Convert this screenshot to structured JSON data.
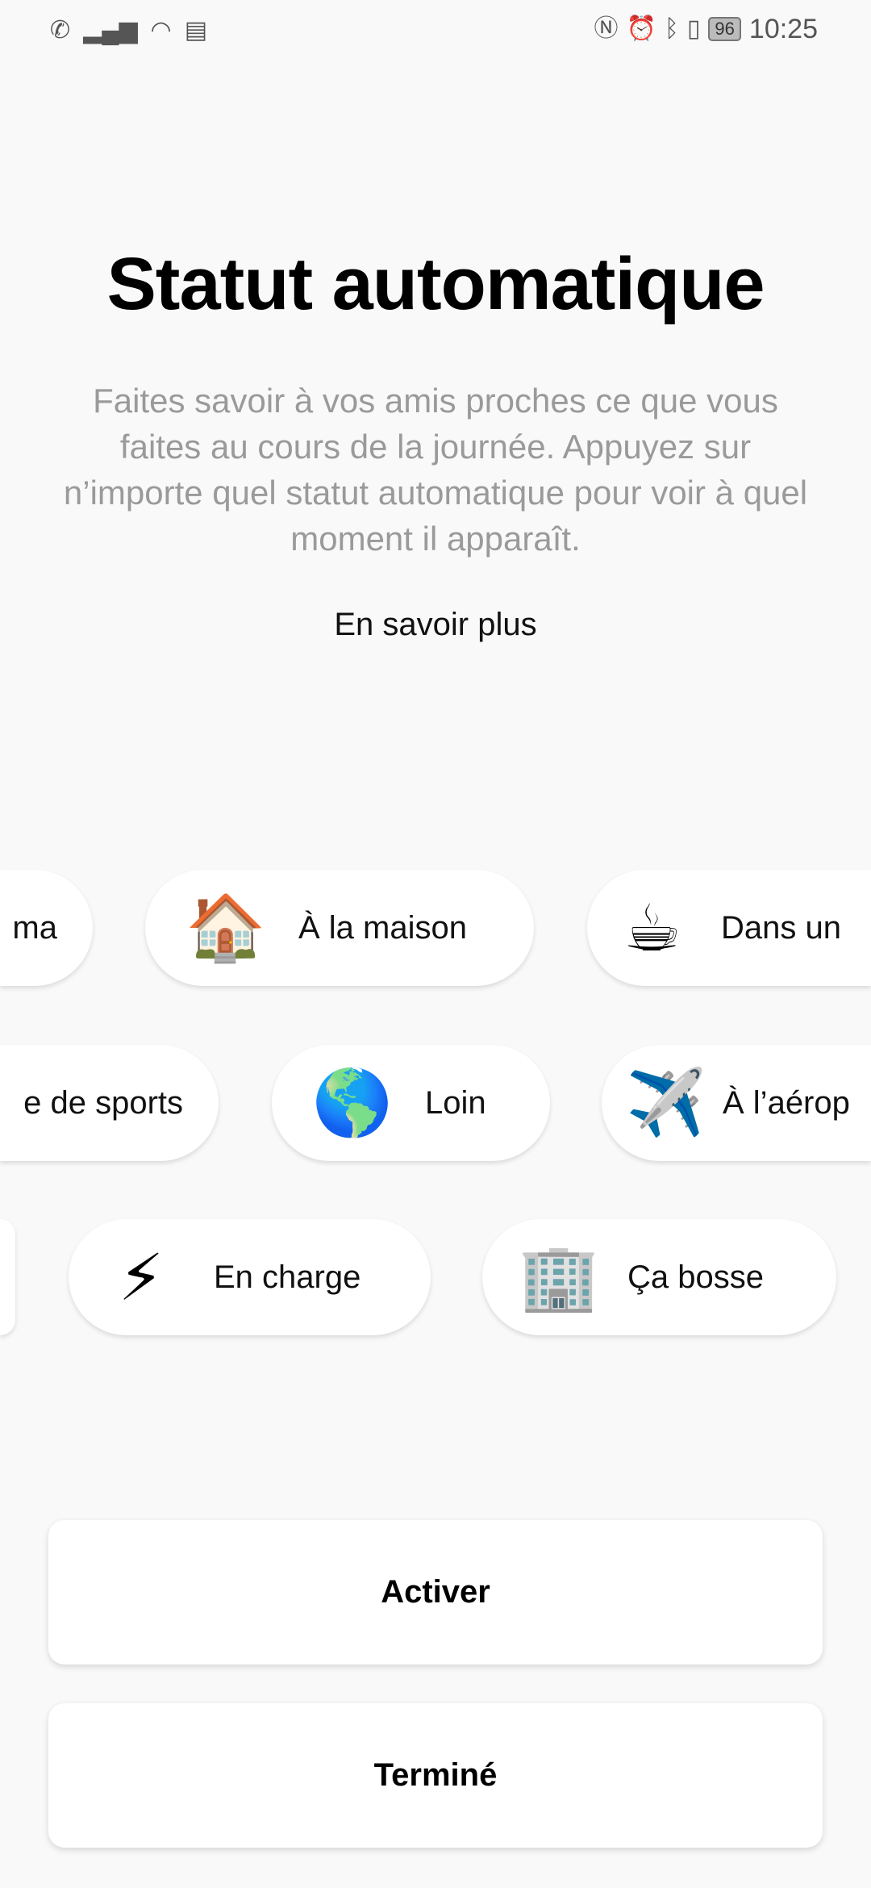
{
  "status_bar": {
    "left_icons": [
      "wifi-calling-icon",
      "signal-icon",
      "wifi-icon",
      "notification-icon"
    ],
    "right_icons": [
      "nfc-icon",
      "alarm-icon",
      "bluetooth-icon",
      "vibrate-icon"
    ],
    "battery": "96",
    "time": "10:25"
  },
  "title": "Statut automatique",
  "description": "Faites savoir à vos amis proches ce que vous faites au cours de la journée. Appuyez sur n’importe quel statut automatique pour voir à quel moment il apparaît.",
  "learn_more": "En savoir plus",
  "statuses": [
    {
      "emoji": "",
      "label": "ma"
    },
    {
      "emoji": "🏠",
      "label": "À la maison"
    },
    {
      "emoji": "☕",
      "label": "Dans un"
    },
    {
      "emoji": "",
      "label": "e de sports"
    },
    {
      "emoji": "🌎",
      "label": "Loin"
    },
    {
      "emoji": "✈️",
      "label": "À l’aérop"
    },
    {
      "emoji": "",
      "label": ""
    },
    {
      "emoji": "⚡",
      "label": "En charge"
    },
    {
      "emoji": "🏢",
      "label": "Ça bosse"
    }
  ],
  "buttons": {
    "activate": "Activer",
    "done": "Terminé"
  }
}
